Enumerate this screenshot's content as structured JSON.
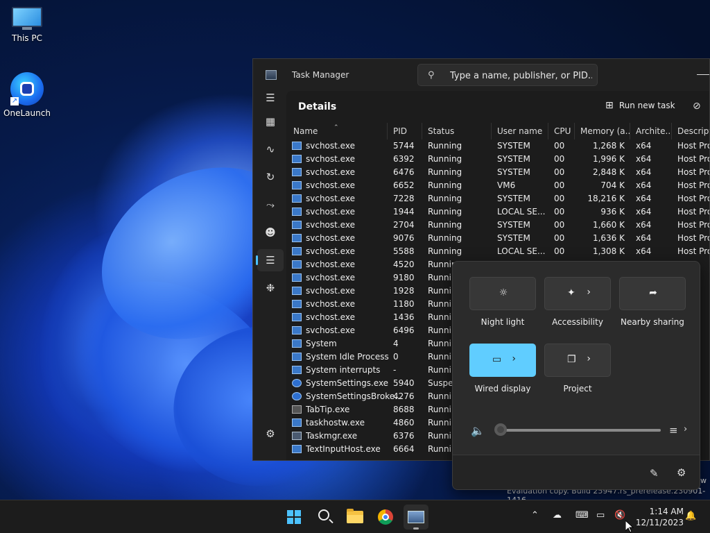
{
  "desktop": {
    "icons": [
      {
        "label": "This PC"
      },
      {
        "label": "OneLaunch"
      }
    ]
  },
  "task_manager": {
    "app_title": "Task Manager",
    "search_placeholder": "Type a name, publisher, or PID...",
    "page_title": "Details",
    "run_new_task": "Run new task",
    "columns": [
      "Name",
      "PID",
      "Status",
      "User name",
      "CPU",
      "Memory (a...",
      "Archite...",
      "Descriptio"
    ],
    "rows": [
      {
        "icon": "service",
        "name": "svchost.exe",
        "pid": "5744",
        "status": "Running",
        "user": "SYSTEM",
        "cpu": "00",
        "memory": "1,268 K",
        "arch": "x64",
        "desc": "Host Proc"
      },
      {
        "icon": "service",
        "name": "svchost.exe",
        "pid": "6392",
        "status": "Running",
        "user": "SYSTEM",
        "cpu": "00",
        "memory": "1,996 K",
        "arch": "x64",
        "desc": "Host Proc"
      },
      {
        "icon": "service",
        "name": "svchost.exe",
        "pid": "6476",
        "status": "Running",
        "user": "SYSTEM",
        "cpu": "00",
        "memory": "2,848 K",
        "arch": "x64",
        "desc": "Host Proc"
      },
      {
        "icon": "service",
        "name": "svchost.exe",
        "pid": "6652",
        "status": "Running",
        "user": "VM6",
        "cpu": "00",
        "memory": "704 K",
        "arch": "x64",
        "desc": "Host Proc"
      },
      {
        "icon": "service",
        "name": "svchost.exe",
        "pid": "7228",
        "status": "Running",
        "user": "SYSTEM",
        "cpu": "00",
        "memory": "18,216 K",
        "arch": "x64",
        "desc": "Host Proc"
      },
      {
        "icon": "service",
        "name": "svchost.exe",
        "pid": "1944",
        "status": "Running",
        "user": "LOCAL SE...",
        "cpu": "00",
        "memory": "936 K",
        "arch": "x64",
        "desc": "Host Proc"
      },
      {
        "icon": "service",
        "name": "svchost.exe",
        "pid": "2704",
        "status": "Running",
        "user": "SYSTEM",
        "cpu": "00",
        "memory": "1,660 K",
        "arch": "x64",
        "desc": "Host Proc"
      },
      {
        "icon": "service",
        "name": "svchost.exe",
        "pid": "9076",
        "status": "Running",
        "user": "SYSTEM",
        "cpu": "00",
        "memory": "1,636 K",
        "arch": "x64",
        "desc": "Host Proc"
      },
      {
        "icon": "service",
        "name": "svchost.exe",
        "pid": "5588",
        "status": "Running",
        "user": "LOCAL SE...",
        "cpu": "00",
        "memory": "1,308 K",
        "arch": "x64",
        "desc": "Host Proc"
      },
      {
        "icon": "service",
        "name": "svchost.exe",
        "pid": "4520",
        "status": "Runnin",
        "user": "",
        "cpu": "",
        "memory": "",
        "arch": "",
        "desc": ""
      },
      {
        "icon": "service",
        "name": "svchost.exe",
        "pid": "9180",
        "status": "Runnin",
        "user": "",
        "cpu": "",
        "memory": "",
        "arch": "",
        "desc": ""
      },
      {
        "icon": "service",
        "name": "svchost.exe",
        "pid": "1928",
        "status": "Runnin",
        "user": "",
        "cpu": "",
        "memory": "",
        "arch": "",
        "desc": ""
      },
      {
        "icon": "service",
        "name": "svchost.exe",
        "pid": "1180",
        "status": "Runnin",
        "user": "",
        "cpu": "",
        "memory": "",
        "arch": "",
        "desc": ""
      },
      {
        "icon": "service",
        "name": "svchost.exe",
        "pid": "1436",
        "status": "Runnin",
        "user": "",
        "cpu": "",
        "memory": "",
        "arch": "",
        "desc": ""
      },
      {
        "icon": "service",
        "name": "svchost.exe",
        "pid": "6496",
        "status": "Runnin",
        "user": "",
        "cpu": "",
        "memory": "",
        "arch": "",
        "desc": ""
      },
      {
        "icon": "service",
        "name": "System",
        "pid": "4",
        "status": "Runnin",
        "user": "",
        "cpu": "",
        "memory": "",
        "arch": "",
        "desc": ""
      },
      {
        "icon": "service",
        "name": "System Idle Process",
        "pid": "0",
        "status": "Runnin",
        "user": "",
        "cpu": "",
        "memory": "",
        "arch": "",
        "desc": ""
      },
      {
        "icon": "service",
        "name": "System interrupts",
        "pid": "-",
        "status": "Runnin",
        "user": "",
        "cpu": "",
        "memory": "",
        "arch": "",
        "desc": ""
      },
      {
        "icon": "gear",
        "name": "SystemSettings.exe",
        "pid": "5940",
        "status": "Suspen",
        "user": "",
        "cpu": "",
        "memory": "",
        "arch": "",
        "desc": ""
      },
      {
        "icon": "gear",
        "name": "SystemSettingsBroke...",
        "pid": "4276",
        "status": "Runnin",
        "user": "",
        "cpu": "",
        "memory": "",
        "arch": "",
        "desc": ""
      },
      {
        "icon": "keyboard",
        "name": "TabTip.exe",
        "pid": "8688",
        "status": "Runnin",
        "user": "",
        "cpu": "",
        "memory": "",
        "arch": "",
        "desc": ""
      },
      {
        "icon": "service",
        "name": "taskhostw.exe",
        "pid": "4860",
        "status": "Runnin",
        "user": "",
        "cpu": "",
        "memory": "",
        "arch": "",
        "desc": ""
      },
      {
        "icon": "taskmgr",
        "name": "Taskmgr.exe",
        "pid": "6376",
        "status": "Runnin",
        "user": "",
        "cpu": "",
        "memory": "",
        "arch": "",
        "desc": ""
      },
      {
        "icon": "service",
        "name": "TextInputHost.exe",
        "pid": "6664",
        "status": "Runnin",
        "user": "",
        "cpu": "",
        "memory": "",
        "arch": "",
        "desc": ""
      }
    ]
  },
  "quick_settings": {
    "tiles": [
      {
        "label": "Night light",
        "icon": "sun-icon",
        "active": false,
        "has_chevron": false
      },
      {
        "label": "Accessibility",
        "icon": "accessibility-icon",
        "active": false,
        "has_chevron": true
      },
      {
        "label": "Nearby sharing",
        "icon": "share-icon",
        "active": false,
        "has_chevron": false
      },
      {
        "label": "Wired display",
        "icon": "cast-icon",
        "active": true,
        "has_chevron": true
      },
      {
        "label": "Project",
        "icon": "project-icon",
        "active": false,
        "has_chevron": true
      }
    ],
    "volume": 0
  },
  "watermark": "Evaluation copy. Build 25947.rs_prerelease.230901-1416",
  "taskbar": {
    "time": "1:14 AM",
    "date": "12/11/2023"
  },
  "colors": {
    "accent": "#60cdff",
    "taskbar_bg": "#1c1c1c",
    "window_bg": "#202020"
  }
}
